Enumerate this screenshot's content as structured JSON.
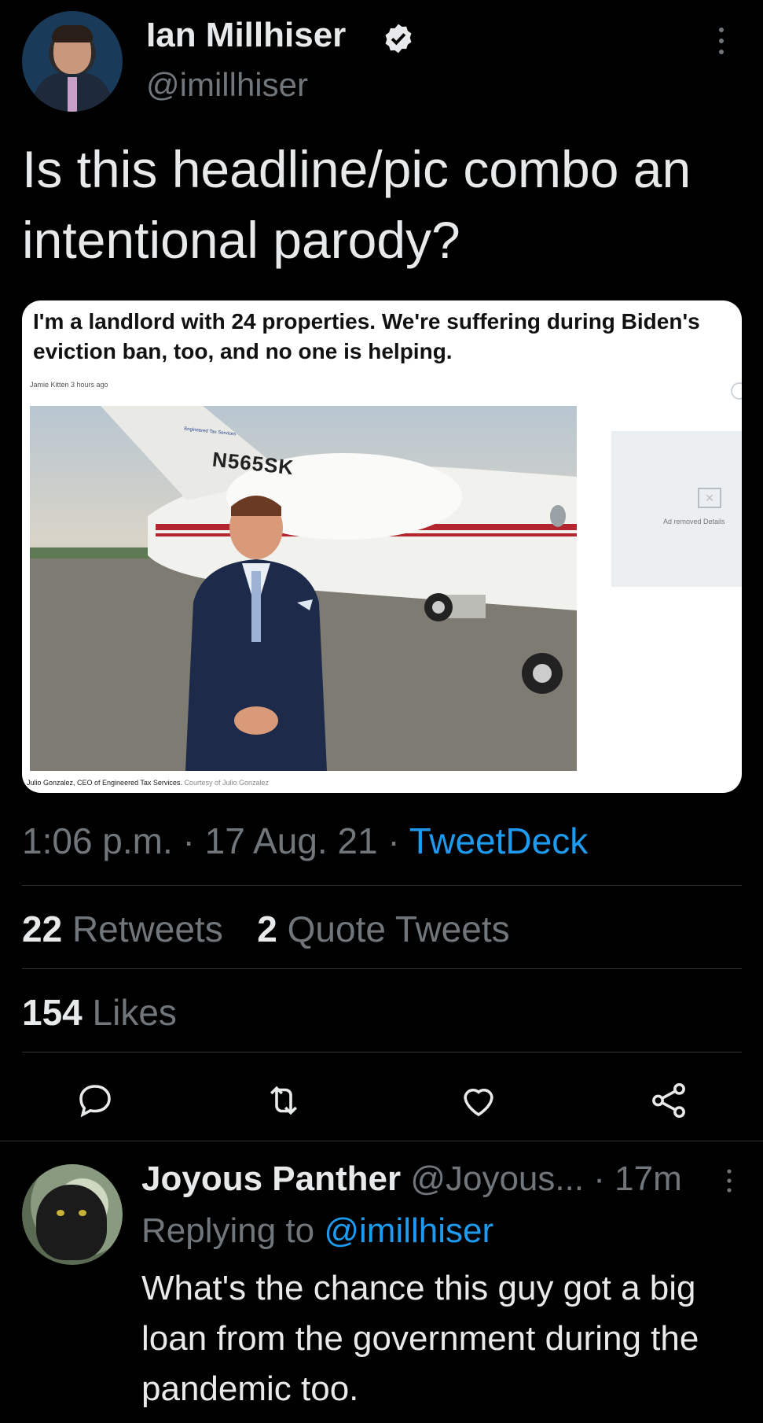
{
  "tweet": {
    "author_name": "Ian Millhiser",
    "author_handle": "@imillhiser",
    "text": "Is this headline/pic combo an intentional parody?",
    "timestamp": "1:06 p.m. · 17 Aug. 21 · ",
    "source": "TweetDeck",
    "retweets_count": "22",
    "retweets_label": " Retweets",
    "quotes_count": "2",
    "quotes_label": " Quote Tweets",
    "likes_count": "154",
    "likes_label": " Likes"
  },
  "embedded_card": {
    "headline": "I'm a landlord with 24 properties. We're suffering during Biden's eviction ban, too, and no one is helping.",
    "byline": "Jamie Kitten 3 hours ago",
    "tail_number": "N565SK",
    "logo_text": "Engineered Tax Services",
    "ad_text": "Ad removed Details",
    "caption": "Julio Gonzalez, CEO of Engineered Tax Services. ",
    "caption_credit": "Courtesy of Julio Gonzalez"
  },
  "reply": {
    "author_name": "Joyous Panther",
    "author_handle": " @Joyous...",
    "time": " · 17m",
    "replying_prefix": "Replying to ",
    "replying_to": "@imillhiser",
    "text": "What's the chance this guy got a big loan from the government during the pandemic too."
  },
  "icons": [
    "verified-badge-icon",
    "more-vertical-icon",
    "reply-icon",
    "retweet-icon",
    "like-icon",
    "share-icon"
  ],
  "colors": {
    "background": "#000000",
    "text": "#e7e9ea",
    "secondary": "#71767b",
    "accent": "#1d9bf0",
    "divider": "#2f3336"
  }
}
